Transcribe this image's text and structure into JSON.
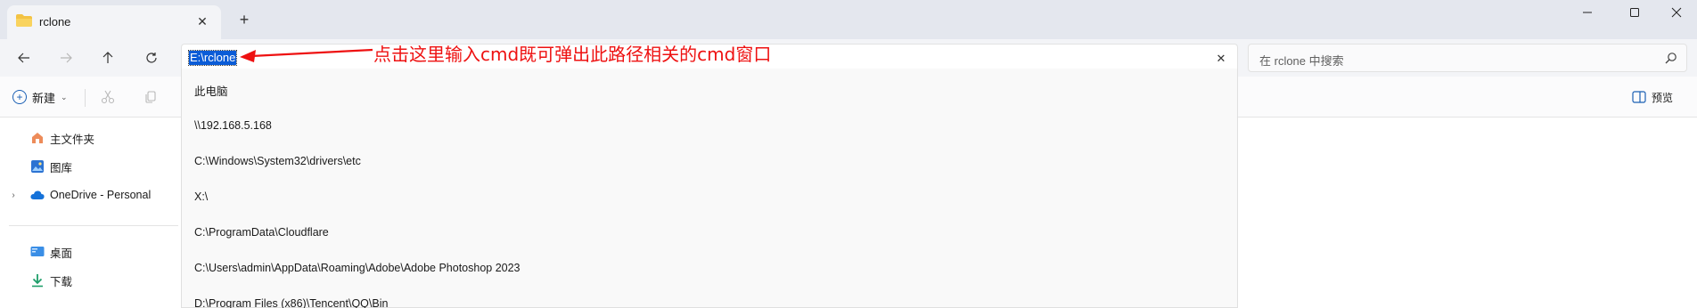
{
  "tab": {
    "title": "rclone",
    "icon": "folder-icon",
    "close_symbol": "✕",
    "new_tab_symbol": "+"
  },
  "window_controls": [
    "minimize-icon",
    "maximize-icon",
    "close-icon"
  ],
  "navigation": {
    "buttons": [
      "back-arrow-icon",
      "forward-arrow-icon",
      "up-arrow-icon",
      "refresh-icon"
    ]
  },
  "address_bar": {
    "value": "E:\\rclone",
    "clear_symbol": "✕"
  },
  "search": {
    "placeholder": "在 rclone 中搜索",
    "icon": "search-icon"
  },
  "annotation": {
    "text": "点击这里输入cmd既可弹出此路径相关的cmd窗口",
    "color": "#ee1111"
  },
  "command_bar": {
    "new_label": "新建",
    "new_caret": "⌄",
    "cut_icon": "scissors-icon",
    "copy_icon": "copy-icon",
    "preview_label": "预览"
  },
  "sidebar": {
    "items": [
      {
        "label": "主文件夹",
        "icon": "home-icon"
      },
      {
        "label": "图库",
        "icon": "gallery-icon"
      },
      {
        "label": "OneDrive - Personal",
        "icon": "cloud-icon",
        "expander": "›"
      },
      {
        "label": "桌面",
        "icon": "desktop-icon"
      },
      {
        "label": "下载",
        "icon": "download-icon"
      }
    ]
  },
  "dropdown": {
    "items": [
      "此电脑",
      "\\\\192.168.5.168",
      "C:\\Windows\\System32\\drivers\\etc",
      "X:\\",
      "C:\\ProgramData\\Cloudflare",
      "C:\\Users\\admin\\AppData\\Roaming\\Adobe\\Adobe Photoshop 2023",
      "D:\\Program Files (x86)\\Tencent\\QQ\\Bin"
    ]
  },
  "colors": {
    "accent": "#005fb8",
    "selection": "#0b5cd7",
    "tabbar": "#e4e7ee"
  }
}
